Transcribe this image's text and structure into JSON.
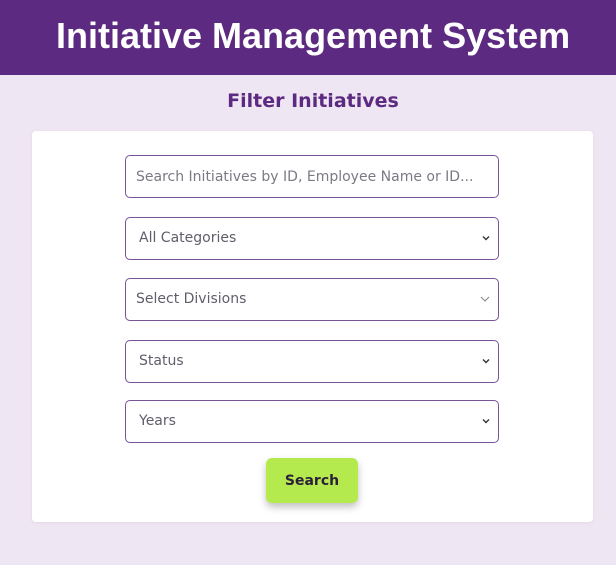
{
  "header": {
    "title": "Initiative Management System"
  },
  "filter": {
    "title": "Filter Initiatives",
    "search_placeholder": "Search Initiatives by ID, Employee Name or ID...",
    "category_selected": "All Categories",
    "division_placeholder": "Select Divisions",
    "status_selected": "Status",
    "years_selected": "Years",
    "search_button": "Search"
  },
  "colors": {
    "header_bg": "#5c2a80",
    "page_bg": "#efe6f3",
    "accent_text": "#5c2a80",
    "field_border": "#7b5496",
    "button_bg": "#b5ea4f"
  }
}
